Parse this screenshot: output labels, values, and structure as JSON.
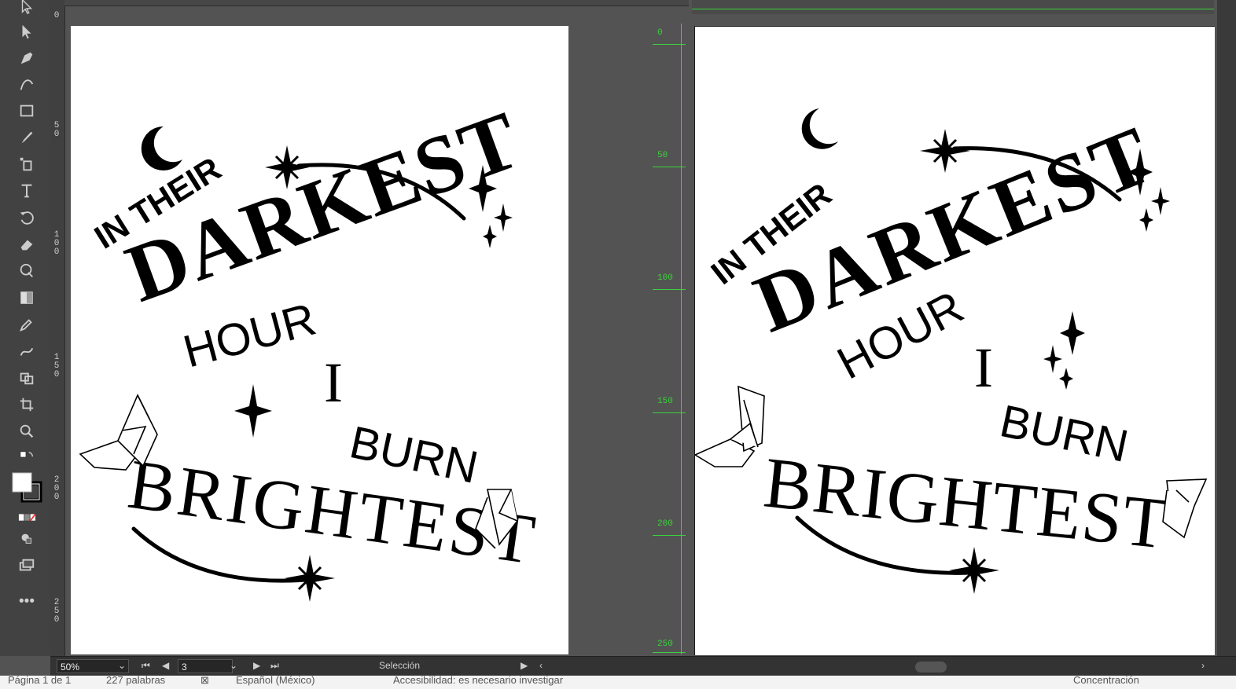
{
  "left_ruler_labels": [
    "0",
    "5\n0",
    "1\n0\n0",
    "1\n5\n0",
    "2\n0\n0",
    "2\n5\n0"
  ],
  "right_ruler_labels": [
    "0",
    "50",
    "100",
    "150",
    "200",
    "250"
  ],
  "artwork": {
    "line1": "IN THEIR",
    "line2": "DARKEST",
    "line3": "HOUR",
    "line4": "I",
    "line5": "BURN",
    "line6": "BRIGHTEST"
  },
  "statusbar": {
    "zoom": "50%",
    "page": "3",
    "tool_label": "Selección"
  },
  "wordbar": {
    "page_info": "Página 1 de 1",
    "words": "227 palabras",
    "language": "Español (México)",
    "accessibility": "Accesibilidad: es necesario investigar",
    "focus": "Concentración"
  },
  "colors": {
    "ui_bg": "#535353",
    "ruler_green": "#3bd33b",
    "ink": "#000000"
  }
}
